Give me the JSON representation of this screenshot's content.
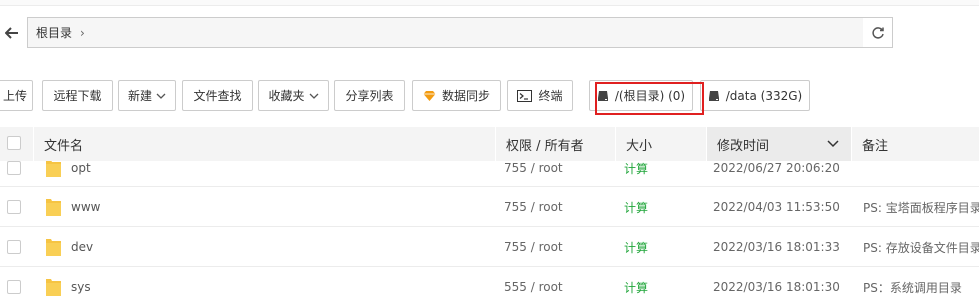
{
  "path": {
    "crumbs": [
      "根目录"
    ],
    "arrow": "›"
  },
  "toolbar": {
    "upload": "上传",
    "remote_download": "远程下载",
    "new": "新建",
    "file_search": "文件查找",
    "favorites": "收藏夹",
    "share_list": "分享列表",
    "data_sync": "数据同步",
    "terminal": "终端",
    "disk_root": "/(根目录) (0)",
    "disk_data": "/data (332G)"
  },
  "table": {
    "headers": {
      "name": "文件名",
      "perm": "权限 / 所有者",
      "size": "大小",
      "mtime": "修改时间",
      "note": "备注"
    },
    "rows": [
      {
        "name": "opt",
        "perm": "755 / root",
        "size": "计算",
        "mtime": "2022/06/27 20:06:20",
        "note": ""
      },
      {
        "name": "www",
        "perm": "755 / root",
        "size": "计算",
        "mtime": "2022/04/03 11:53:50",
        "note": "PS: 宝塔面板程序目录"
      },
      {
        "name": "dev",
        "perm": "755 / root",
        "size": "计算",
        "mtime": "2022/03/16 18:01:33",
        "note": "PS: 存放设备文件目录"
      },
      {
        "name": "sys",
        "perm": "555 / root",
        "size": "计算",
        "mtime": "2022/03/16 18:01:30",
        "note": "PS：系统调用目录"
      }
    ]
  },
  "colors": {
    "accent_green": "#20a53a",
    "highlight_red": "#e02020",
    "folder_yellow": "#f6c443",
    "sync_orange": "#f39c12"
  },
  "icons": {
    "back": "arrow-left-icon",
    "refresh": "refresh-icon",
    "caret": "chevron-down-icon",
    "sync": "diamond-icon",
    "terminal": "terminal-icon",
    "disk": "disk-icon",
    "folder": "folder-icon"
  }
}
